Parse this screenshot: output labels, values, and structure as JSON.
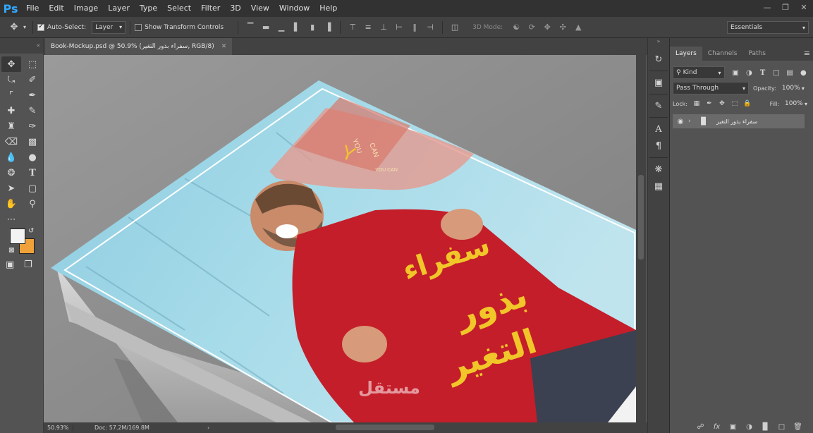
{
  "app": {
    "logo": "Ps",
    "menu": [
      "File",
      "Edit",
      "Image",
      "Layer",
      "Type",
      "Select",
      "Filter",
      "3D",
      "View",
      "Window",
      "Help"
    ],
    "window_controls": [
      "minimize-icon",
      "restore-icon",
      "close-icon"
    ]
  },
  "options": {
    "auto_select_label": "Auto-Select:",
    "auto_select_checked": true,
    "layer_select_value": "Layer",
    "show_transform_label": "Show Transform Controls",
    "show_transform_checked": false,
    "mode_3d_label": "3D Mode:",
    "workspace_value": "Essentials"
  },
  "document": {
    "tab_title": "Book-Mockup.psd @ 50.9% (سفراء بذور التغير, RGB/8)",
    "zoom_readout": "50.93%",
    "doc_size": "Doc: 57.2M/169.8M",
    "artwork": {
      "logo_text_top": "YOU",
      "logo_text_mid": "CAN",
      "logo_text_small": "YOU CAN",
      "title_line1": "سفراء",
      "title_line2": "بذور",
      "title_line3": "التغير",
      "watermark": "مستقل"
    }
  },
  "layers_panel": {
    "tabs": [
      "Layers",
      "Channels",
      "Paths"
    ],
    "active_tab": "Layers",
    "filter_kind": "Kind",
    "blend_mode": "Pass Through",
    "opacity_label": "Opacity:",
    "opacity_value": "100%",
    "lock_label": "Lock:",
    "fill_label": "Fill:",
    "fill_value": "100%",
    "layers": [
      {
        "name": "سفراء بذور التغير",
        "type": "group",
        "visible": true
      }
    ]
  },
  "colors": {
    "foreground": "#f3f3f3",
    "background": "#f0a23a",
    "accent_ps": "#31a8ff"
  }
}
